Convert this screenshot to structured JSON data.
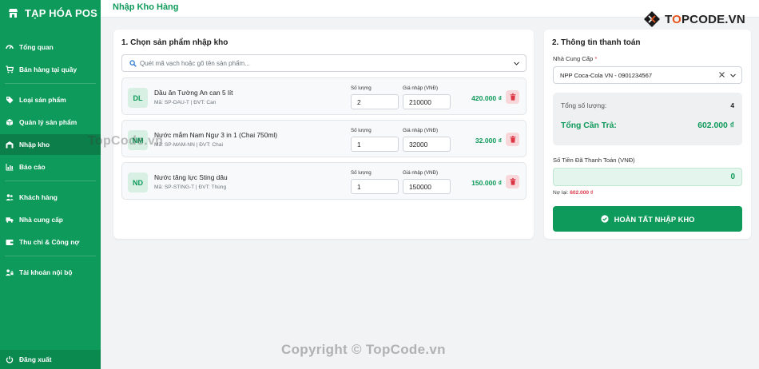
{
  "app": {
    "brand": "TẠP HÓA POS",
    "accent": "#0e9a5a"
  },
  "sidebar": {
    "items": [
      {
        "label": "Tổng quan",
        "icon": "gauge-icon"
      },
      {
        "label": "Bán hàng tại quầy",
        "icon": "cart-icon"
      },
      {
        "label": "Loại sản phẩm",
        "icon": "tag-icon"
      },
      {
        "label": "Quản lý sản phẩm",
        "icon": "box-icon"
      },
      {
        "label": "Nhập kho",
        "icon": "warehouse-icon",
        "active": true
      },
      {
        "label": "Báo cáo",
        "icon": "chart-icon"
      },
      {
        "label": "Khách hàng",
        "icon": "users-icon"
      },
      {
        "label": "Nhà cung cấp",
        "icon": "truck-icon"
      },
      {
        "label": "Thu chi & Công nợ",
        "icon": "wallet-icon"
      },
      {
        "label": "Tài khoản nội bộ",
        "icon": "user-lock-icon"
      }
    ],
    "logout": "Đăng xuất"
  },
  "header": {
    "title": "Nhập Kho Hàng"
  },
  "products_card": {
    "title": "1. Chọn sản phẩm nhập kho",
    "search_placeholder": "Quét mã vạch hoặc gõ tên sản phẩm...",
    "qty_label": "Số lượng",
    "price_label": "Giá nhập (VNĐ)",
    "rows": [
      {
        "initials": "DL",
        "name": "Dầu ăn Tường An can 5 lít",
        "meta": "Mã: SP-DAU-T | ĐVT: Can",
        "qty": "2",
        "price": "210000",
        "total": "420.000 ₫"
      },
      {
        "initials": "NM",
        "name": "Nước mắm Nam Ngư 3 in 1 (Chai 750ml)",
        "meta": "Mã: SP-MAM-NN | ĐVT: Chai",
        "qty": "1",
        "price": "32000",
        "total": "32.000 ₫"
      },
      {
        "initials": "ND",
        "name": "Nước tăng lực Sting dâu",
        "meta": "Mã: SP-STING-T | ĐVT: Thùng",
        "qty": "1",
        "price": "150000",
        "total": "150.000 ₫"
      }
    ]
  },
  "payment_card": {
    "title": "2. Thông tin thanh toán",
    "supplier_label": "Nhà Cung Cấp",
    "supplier_required": "*",
    "supplier_value": "NPP Coca-Cola VN - 0901234567",
    "qty_label": "Tổng số lượng:",
    "qty_value": "4",
    "total_label": "Tổng Cần Trả:",
    "total_value": "602.000 ₫",
    "paid_label": "Số Tiền Đã Thanh Toán (VNĐ)",
    "paid_value": "0",
    "debt_label": "Nợ lại:",
    "debt_value": "602.000 ₫",
    "submit_label": "HOÀN TẤT NHẬP KHO"
  },
  "watermarks": {
    "logo_text_a": "T",
    "logo_text_o": "O",
    "logo_text_b": "PCODE.VN",
    "middle": "TopCode.vn",
    "bottom": "Copyright © TopCode.vn"
  }
}
